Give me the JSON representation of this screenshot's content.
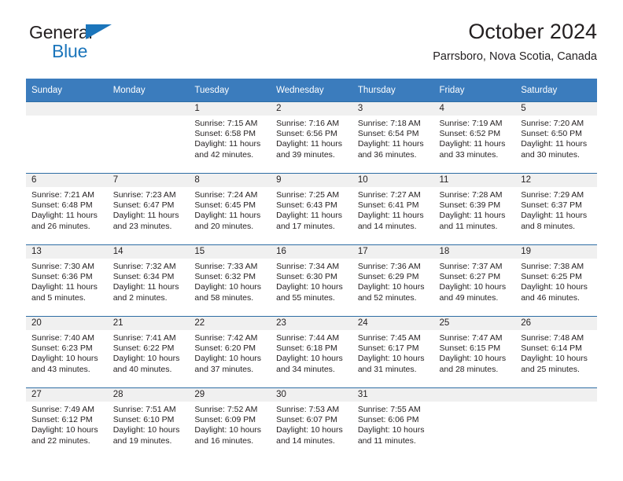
{
  "brand": {
    "line1": "General",
    "line2": "Blue",
    "triangle_color": "#1b75bb"
  },
  "header": {
    "title": "October 2024",
    "subtitle": "Parrsboro, Nova Scotia, Canada"
  },
  "theme": {
    "header_bg": "#3b7cbd",
    "row_border": "#2e6da4",
    "daynum_bg": "#f0f0f0",
    "text": "#231f20"
  },
  "weekday_headers": [
    "Sunday",
    "Monday",
    "Tuesday",
    "Wednesday",
    "Thursday",
    "Friday",
    "Saturday"
  ],
  "weeks": [
    [
      {
        "day": "",
        "sunrise": "",
        "sunset": "",
        "daylight": ""
      },
      {
        "day": "",
        "sunrise": "",
        "sunset": "",
        "daylight": ""
      },
      {
        "day": "1",
        "sunrise": "Sunrise: 7:15 AM",
        "sunset": "Sunset: 6:58 PM",
        "daylight": "Daylight: 11 hours and 42 minutes."
      },
      {
        "day": "2",
        "sunrise": "Sunrise: 7:16 AM",
        "sunset": "Sunset: 6:56 PM",
        "daylight": "Daylight: 11 hours and 39 minutes."
      },
      {
        "day": "3",
        "sunrise": "Sunrise: 7:18 AM",
        "sunset": "Sunset: 6:54 PM",
        "daylight": "Daylight: 11 hours and 36 minutes."
      },
      {
        "day": "4",
        "sunrise": "Sunrise: 7:19 AM",
        "sunset": "Sunset: 6:52 PM",
        "daylight": "Daylight: 11 hours and 33 minutes."
      },
      {
        "day": "5",
        "sunrise": "Sunrise: 7:20 AM",
        "sunset": "Sunset: 6:50 PM",
        "daylight": "Daylight: 11 hours and 30 minutes."
      }
    ],
    [
      {
        "day": "6",
        "sunrise": "Sunrise: 7:21 AM",
        "sunset": "Sunset: 6:48 PM",
        "daylight": "Daylight: 11 hours and 26 minutes."
      },
      {
        "day": "7",
        "sunrise": "Sunrise: 7:23 AM",
        "sunset": "Sunset: 6:47 PM",
        "daylight": "Daylight: 11 hours and 23 minutes."
      },
      {
        "day": "8",
        "sunrise": "Sunrise: 7:24 AM",
        "sunset": "Sunset: 6:45 PM",
        "daylight": "Daylight: 11 hours and 20 minutes."
      },
      {
        "day": "9",
        "sunrise": "Sunrise: 7:25 AM",
        "sunset": "Sunset: 6:43 PM",
        "daylight": "Daylight: 11 hours and 17 minutes."
      },
      {
        "day": "10",
        "sunrise": "Sunrise: 7:27 AM",
        "sunset": "Sunset: 6:41 PM",
        "daylight": "Daylight: 11 hours and 14 minutes."
      },
      {
        "day": "11",
        "sunrise": "Sunrise: 7:28 AM",
        "sunset": "Sunset: 6:39 PM",
        "daylight": "Daylight: 11 hours and 11 minutes."
      },
      {
        "day": "12",
        "sunrise": "Sunrise: 7:29 AM",
        "sunset": "Sunset: 6:37 PM",
        "daylight": "Daylight: 11 hours and 8 minutes."
      }
    ],
    [
      {
        "day": "13",
        "sunrise": "Sunrise: 7:30 AM",
        "sunset": "Sunset: 6:36 PM",
        "daylight": "Daylight: 11 hours and 5 minutes."
      },
      {
        "day": "14",
        "sunrise": "Sunrise: 7:32 AM",
        "sunset": "Sunset: 6:34 PM",
        "daylight": "Daylight: 11 hours and 2 minutes."
      },
      {
        "day": "15",
        "sunrise": "Sunrise: 7:33 AM",
        "sunset": "Sunset: 6:32 PM",
        "daylight": "Daylight: 10 hours and 58 minutes."
      },
      {
        "day": "16",
        "sunrise": "Sunrise: 7:34 AM",
        "sunset": "Sunset: 6:30 PM",
        "daylight": "Daylight: 10 hours and 55 minutes."
      },
      {
        "day": "17",
        "sunrise": "Sunrise: 7:36 AM",
        "sunset": "Sunset: 6:29 PM",
        "daylight": "Daylight: 10 hours and 52 minutes."
      },
      {
        "day": "18",
        "sunrise": "Sunrise: 7:37 AM",
        "sunset": "Sunset: 6:27 PM",
        "daylight": "Daylight: 10 hours and 49 minutes."
      },
      {
        "day": "19",
        "sunrise": "Sunrise: 7:38 AM",
        "sunset": "Sunset: 6:25 PM",
        "daylight": "Daylight: 10 hours and 46 minutes."
      }
    ],
    [
      {
        "day": "20",
        "sunrise": "Sunrise: 7:40 AM",
        "sunset": "Sunset: 6:23 PM",
        "daylight": "Daylight: 10 hours and 43 minutes."
      },
      {
        "day": "21",
        "sunrise": "Sunrise: 7:41 AM",
        "sunset": "Sunset: 6:22 PM",
        "daylight": "Daylight: 10 hours and 40 minutes."
      },
      {
        "day": "22",
        "sunrise": "Sunrise: 7:42 AM",
        "sunset": "Sunset: 6:20 PM",
        "daylight": "Daylight: 10 hours and 37 minutes."
      },
      {
        "day": "23",
        "sunrise": "Sunrise: 7:44 AM",
        "sunset": "Sunset: 6:18 PM",
        "daylight": "Daylight: 10 hours and 34 minutes."
      },
      {
        "day": "24",
        "sunrise": "Sunrise: 7:45 AM",
        "sunset": "Sunset: 6:17 PM",
        "daylight": "Daylight: 10 hours and 31 minutes."
      },
      {
        "day": "25",
        "sunrise": "Sunrise: 7:47 AM",
        "sunset": "Sunset: 6:15 PM",
        "daylight": "Daylight: 10 hours and 28 minutes."
      },
      {
        "day": "26",
        "sunrise": "Sunrise: 7:48 AM",
        "sunset": "Sunset: 6:14 PM",
        "daylight": "Daylight: 10 hours and 25 minutes."
      }
    ],
    [
      {
        "day": "27",
        "sunrise": "Sunrise: 7:49 AM",
        "sunset": "Sunset: 6:12 PM",
        "daylight": "Daylight: 10 hours and 22 minutes."
      },
      {
        "day": "28",
        "sunrise": "Sunrise: 7:51 AM",
        "sunset": "Sunset: 6:10 PM",
        "daylight": "Daylight: 10 hours and 19 minutes."
      },
      {
        "day": "29",
        "sunrise": "Sunrise: 7:52 AM",
        "sunset": "Sunset: 6:09 PM",
        "daylight": "Daylight: 10 hours and 16 minutes."
      },
      {
        "day": "30",
        "sunrise": "Sunrise: 7:53 AM",
        "sunset": "Sunset: 6:07 PM",
        "daylight": "Daylight: 10 hours and 14 minutes."
      },
      {
        "day": "31",
        "sunrise": "Sunrise: 7:55 AM",
        "sunset": "Sunset: 6:06 PM",
        "daylight": "Daylight: 10 hours and 11 minutes."
      },
      {
        "day": "",
        "sunrise": "",
        "sunset": "",
        "daylight": ""
      },
      {
        "day": "",
        "sunrise": "",
        "sunset": "",
        "daylight": ""
      }
    ]
  ]
}
